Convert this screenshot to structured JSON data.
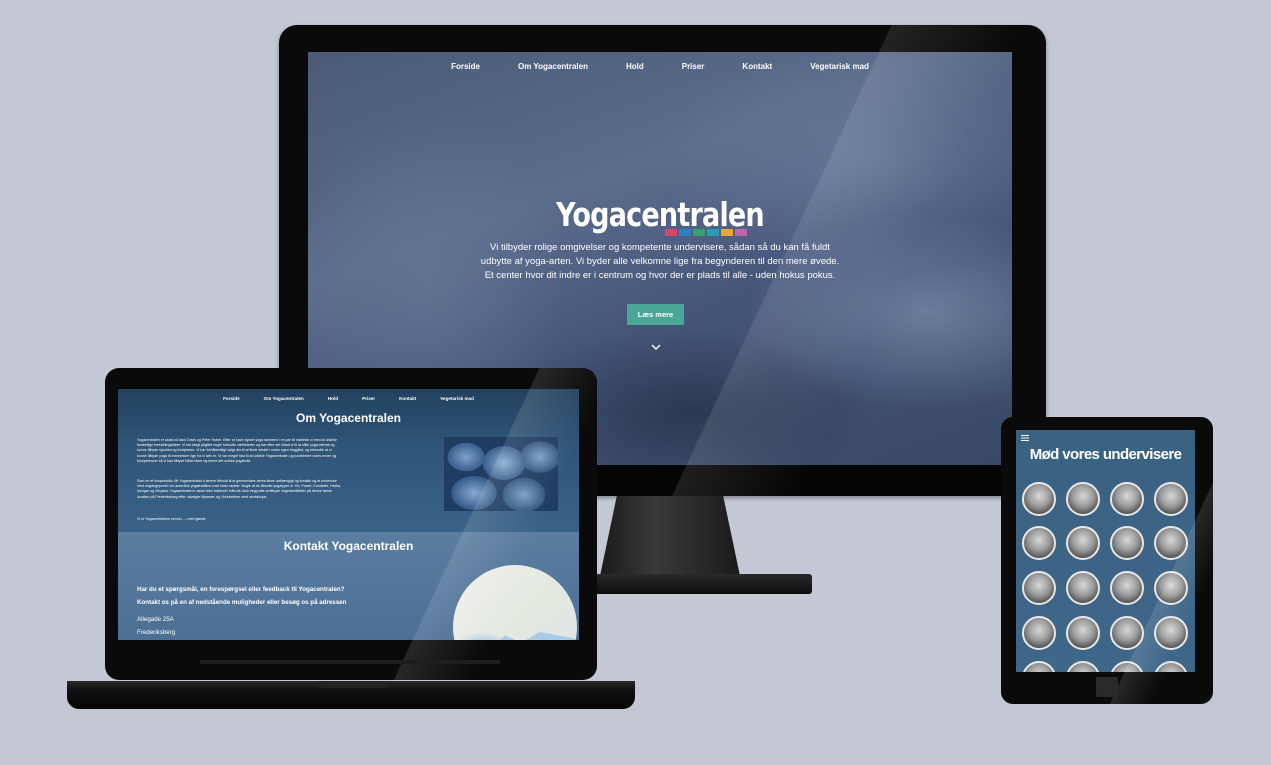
{
  "desktop": {
    "nav": [
      "Forside",
      "Om Yogacentralen",
      "Hold",
      "Priser",
      "Kontakt",
      "Vegetarisk mad"
    ],
    "hero_title": "Yogacentralen",
    "hero_colors": [
      "#d9436e",
      "#2f7fc3",
      "#3aa06a",
      "#2b9bb0",
      "#e6a43a",
      "#c064a8"
    ],
    "hero_text": "Vi tilbyder rolige omgivelser og kompetente undervisere, sådan så du kan få fuldt udbytte af yoga-arten. Vi byder alle velkomne lige fra begynderen til den mere øvede. Et center hvor dit indre er i centrum og hvor der er plads til alle - uden hokus pokus.",
    "hero_button": "Læs mere",
    "scroll_icon": "chevron-down-icon",
    "accent_color": "#4aa796"
  },
  "laptop": {
    "nav": [
      "Forside",
      "Om Yogacentralen",
      "Hold",
      "Priser",
      "Kontakt",
      "Vegetarisk mad"
    ],
    "about_title": "Om Yogacentralen",
    "about_p1": "Yogacentralen er skabt af Jack Davis og Peter Huber. Efter at have dyrket yoga sammen i en par år startede vi med at udvikle forskellige forestillingsideer. Vi har langt pågået nogle forbudte værksteder og har efter det tilladt vi til at stille yoga-retreat og kunne tilbyde sjovhed og fordybelse. Vi har forhåbentligt valgt der til at finde stedet i vores egen baggård, og erkendte at vi kunne tilbyde yoga til mennesker lige fra vi selv er. Vi var meget fast til at udvikle Yogacentralen og kombinere vores evner og kompetencer så vi kan tilbyde både ideer og kerne det unikke yogahold.",
    "about_p2": "Som en et hovpersidiv, får Yogacentralen's lærere fritvold til at gennemføre deres timer uafhængigt og kreativt og at undervise med udgangspunkt i en autentisk yogatradition med klare rødder. Nogle af de tilbudte yogatyper er Yin, Power, Kundalini, Hatha, Iyengar og Vinyasa. Yogacentralen's vision blev fuldendt i tråd da Jack begyndte at tilbyde vegetarmåltider på denne fønde location på Frederiksberg efter udvalgte tilpasser og i forbindelse med workshops.",
    "about_p3": "Vi er Yogacentralens venner — med glæde.",
    "contact_title": "Kontakt Yogacentralen",
    "contact_q1": "Har du et spørgsmål, en forespørgsel eller feedback til Yogacentralen?",
    "contact_q2": "Kontakt os på en af nedstående muligheder eller besøg os på adressen",
    "address_street": "Allegade 25A",
    "address_city": "Frederiksberg"
  },
  "tablet": {
    "title": "Mød vores undervisere",
    "menu_icon": "hamburger-icon",
    "teacher_count_visible": 18
  }
}
